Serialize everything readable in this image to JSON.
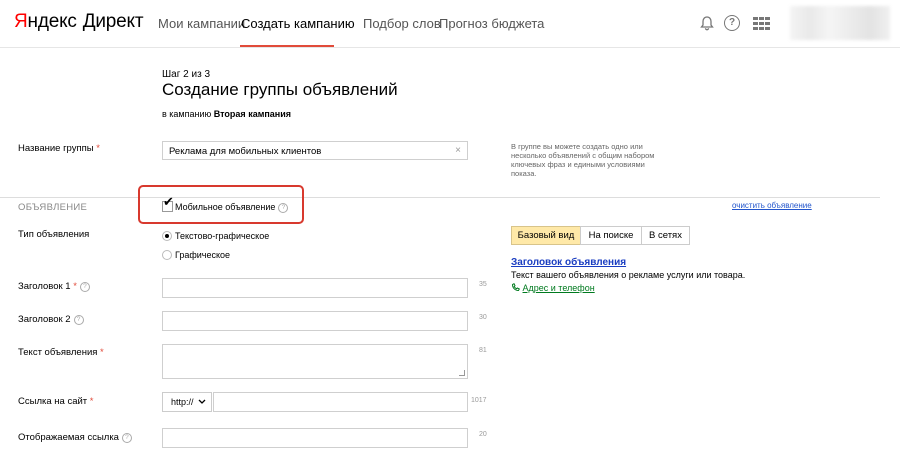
{
  "header": {
    "logo_brand_first": "Я",
    "logo_brand_rest": "ндекс",
    "logo_product": "Директ",
    "nav": [
      {
        "label": "Мои кампании"
      },
      {
        "label": "Создать кампанию",
        "active": true
      },
      {
        "label": "Подбор слов"
      },
      {
        "label": "Прогноз бюджета"
      }
    ],
    "help_glyph": "?"
  },
  "page": {
    "step": "Шаг 2 из 3",
    "title": "Создание группы объявлений",
    "campaign_prefix": "в кампанию",
    "campaign_name": "Вторая кампания"
  },
  "group_name": {
    "label": "Название группы",
    "required_mark": "*",
    "value": "Реклама для мобильных клиентов",
    "clear_glyph": "×",
    "hint": "В группе вы можете создать одно или несколько объявлений с общим набором ключевых фраз и едиными условиями показа."
  },
  "ad_section": {
    "title": "ОБЪЯВЛЕНИЕ",
    "mobile_checkbox_label": "Мобильное объявление",
    "mobile_checked": true,
    "checkmark_glyph": "✔",
    "clear_link": "очистить объявление"
  },
  "ad_type": {
    "label": "Тип объявления",
    "options": [
      {
        "label": "Текстово-графическое",
        "selected": true
      },
      {
        "label": "Графическое",
        "selected": false
      }
    ]
  },
  "fields": {
    "headline1": {
      "label": "Заголовок 1",
      "required_mark": "*",
      "counter": "35"
    },
    "headline2": {
      "label": "Заголовок 2",
      "counter": "30"
    },
    "text": {
      "label": "Текст объявления",
      "required_mark": "*",
      "counter": "81"
    },
    "url": {
      "label": "Ссылка на сайт",
      "required_mark": "*",
      "protocol": "http://",
      "counter": "1017"
    },
    "display_url": {
      "label": "Отображаемая ссылка",
      "counter": "20"
    }
  },
  "preview": {
    "tabs": [
      {
        "label": "Базовый вид",
        "active": true
      },
      {
        "label": "На поиске"
      },
      {
        "label": "В сетях"
      }
    ],
    "ad_title": "Заголовок объявления",
    "ad_text": "Текст вашего объявления о рекламе услуги или товара.",
    "ad_link": "Адрес и телефон"
  },
  "colors": {
    "accent_red": "#e14b3a",
    "link_blue": "#1a3dc1",
    "active_tab": "#ffe9a8",
    "highlight_border": "#d8392e"
  }
}
